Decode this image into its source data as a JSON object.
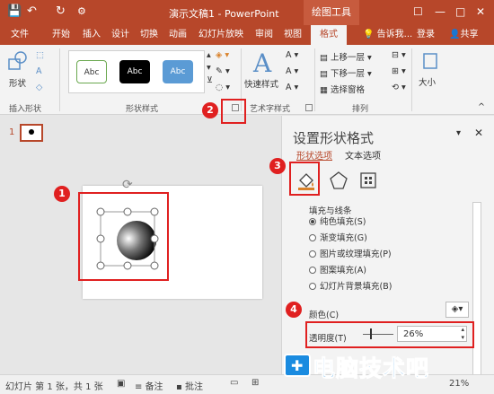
{
  "titlebar": {
    "save_glyph": "💾",
    "undo_glyph": "↶",
    "redo_glyph": "↻",
    "doc_title": "演示文稿1 - PowerPoint",
    "context_group": "绘图工具",
    "controls": [
      "☐",
      "—",
      "□",
      "✕"
    ]
  },
  "tabs": [
    {
      "label": "文件"
    },
    {
      "label": "开始"
    },
    {
      "label": "插入"
    },
    {
      "label": "设计"
    },
    {
      "label": "切换"
    },
    {
      "label": "动画"
    },
    {
      "label": "幻灯片放映"
    },
    {
      "label": "审阅"
    },
    {
      "label": "视图"
    },
    {
      "label": "格式"
    }
  ],
  "tellme": "告诉我...",
  "signin": "登录",
  "share": "共享",
  "ribbon": {
    "insert_shapes_label": "插入形状",
    "shapes_btn": "形状",
    "shape_styles_label": "形状样式",
    "style_sample": "Abc",
    "quick_styles": "快速样式",
    "wordart_label": "艺术字样式",
    "bring_forward": "上移一层",
    "send_backward": "下移一层",
    "selection_pane": "选择窗格",
    "arrange_label": "排列",
    "size_btn": "大小"
  },
  "thumbnails": {
    "number": "1"
  },
  "pane": {
    "title": "设置形状格式",
    "tab_shape": "形状选项",
    "tab_text": "文本选项",
    "section": "填充与线条",
    "fill_options": [
      "纯色填充(S)",
      "渐变填充(G)",
      "图片或纹理填充(P)",
      "图案填充(A)",
      "幻灯片背景填充(B)"
    ],
    "color_label": "颜色(C)",
    "transparency_label": "透明度(T)",
    "transparency_value": "26%",
    "close_glyph": "✕",
    "dropdown_glyph": "▾"
  },
  "status": {
    "slide_info": "幻灯片 第 1 张，共 1 张",
    "notes": "备注",
    "comments": "批注",
    "zoom": "21%"
  },
  "annotations": [
    "1",
    "2",
    "3",
    "4"
  ],
  "watermark": "电脑技术吧",
  "colors": {
    "accent": "#b7472a",
    "annotation": "#e02020",
    "watermark": "#1a8be0"
  }
}
